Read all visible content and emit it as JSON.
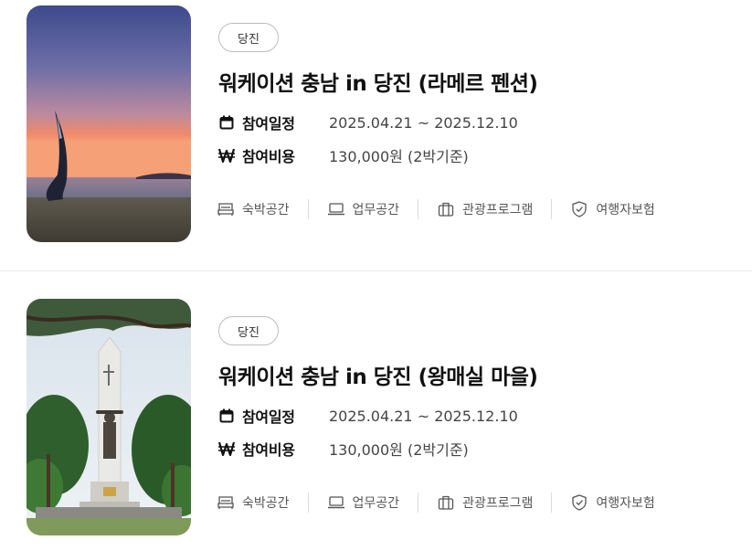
{
  "programs": [
    {
      "region_tag": "당진",
      "title": "워케이션 충남 in 당진 (라메르 펜션)",
      "schedule_label": "참여일정",
      "schedule_value": "2025.04.21 ~ 2025.12.10",
      "cost_label": "참여비용",
      "cost_value": "130,000원 (2박기준)",
      "features": [
        "숙박공간",
        "업무공간",
        "관광프로그램",
        "여행자보험"
      ],
      "image_icon": "sunset-beach-sculpture-photo"
    },
    {
      "region_tag": "당진",
      "title": "워케이션 충남 in 당진 (왕매실 마을)",
      "schedule_label": "참여일정",
      "schedule_value": "2025.04.21 ~ 2025.12.10",
      "cost_label": "참여비용",
      "cost_value": "130,000원 (2박기준)",
      "features": [
        "숙박공간",
        "업무공간",
        "관광프로그램",
        "여행자보험"
      ],
      "image_icon": "monument-statue-pine-trees-photo"
    }
  ],
  "icons": {
    "schedule": "calendar-icon",
    "cost": "won-sign-icon",
    "features": [
      "bed-icon",
      "laptop-icon",
      "suitcase-icon",
      "shield-check-icon"
    ]
  },
  "colors": {
    "text": "#111111",
    "muted": "#555555",
    "border": "#bdbdbd",
    "divider": "#e9e9e9"
  }
}
